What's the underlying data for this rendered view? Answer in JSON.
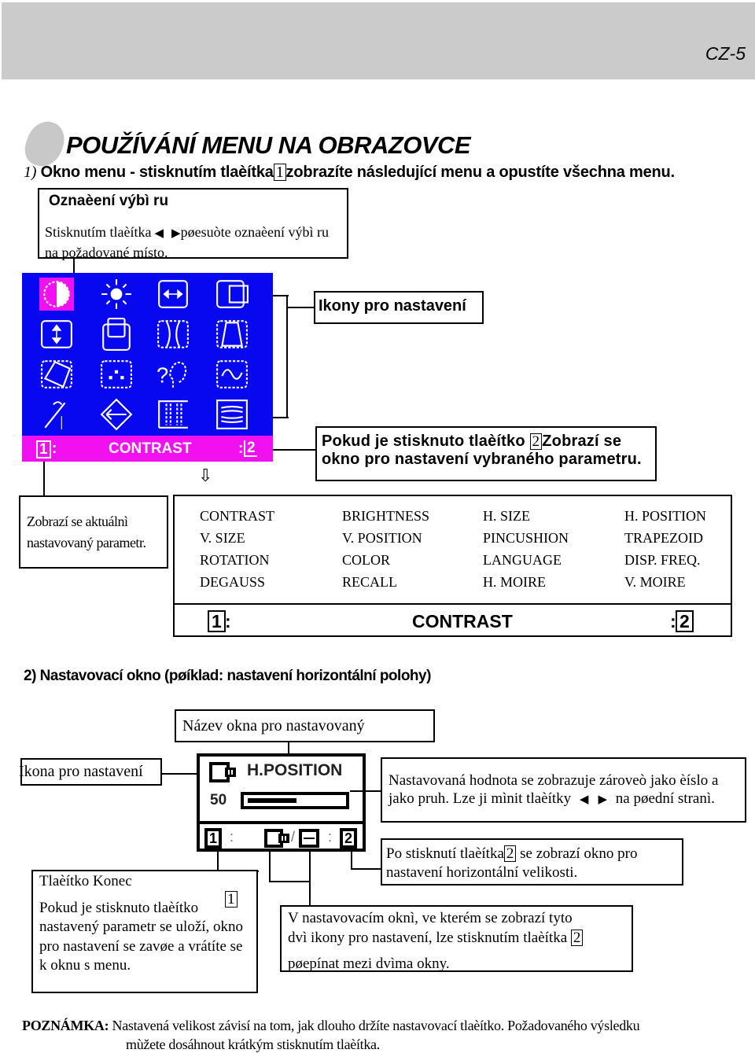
{
  "header": {
    "page_number": "CZ-5"
  },
  "title": "POUŽÍVÁNÍ MENU NA OBRAZOVCE",
  "step1": {
    "number": "1)",
    "text_before": "Okno menu - stisknutím tlaèítka",
    "key": "1",
    "text_after": "zobrazíte následující menu a opustíte všechna menu."
  },
  "selection_callout": {
    "heading": "Oznaèení výbì ru",
    "text_before": "Stisknutím tlaèítka",
    "left_arrow": "◀",
    "right_arrow": "▶",
    "text_after": "pøesuòte oznaèení výbì ru na požadované místo."
  },
  "osd_menu": {
    "colors": {
      "background": "#0808f0",
      "highlight": "#f010f0",
      "foreground": "#ffffff"
    },
    "icons": [
      [
        "contrast-icon",
        "brightness-icon",
        "h-size-icon",
        "h-position-icon"
      ],
      [
        "v-size-icon",
        "v-position-icon",
        "pincushion-icon",
        "trapezoid-icon"
      ],
      [
        "rotation-icon",
        "color-icon",
        "language-icon",
        "disp-freq-icon"
      ],
      [
        "degauss-icon",
        "recall-icon",
        "h-moire-icon",
        "v-moire-icon"
      ]
    ],
    "selected_index": 0,
    "status_bar": {
      "left_key": "1",
      "left_sep": ":",
      "label": "CONTRAST",
      "right_sep": ":",
      "right_key": "2"
    },
    "down_arrow": "⇩"
  },
  "icons_callout": "Ikony pro nastavení",
  "button2_callout": {
    "text_before": "Pokud je stisknuto tlaèítko",
    "key": "2",
    "text_after": "Zobrazí se okno pro nastavení vybraného parametru."
  },
  "current_param_callout": "Zobrazí se aktuálnì nastavovaný parametr.",
  "parameter_table": {
    "rows": [
      [
        "CONTRAST",
        "BRIGHTNESS",
        "H. SIZE",
        "H. POSITION"
      ],
      [
        "V. SIZE",
        "V. POSITION",
        "PINCUSHION",
        "TRAPEZOID"
      ],
      [
        "ROTATION",
        "COLOR",
        "LANGUAGE",
        "DISP. FREQ."
      ],
      [
        "DEGAUSS",
        "RECALL",
        "H. MOIRE",
        "V. MOIRE"
      ]
    ],
    "footer": {
      "left_key": "1",
      "left_sep": ":",
      "label": "CONTRAST",
      "right_sep": ":",
      "right_key": "2"
    }
  },
  "step2": {
    "text": "2) Nastavovací okno (pøíklad: nastavení horizontální polohy)"
  },
  "window_name_callout": "Název okna pro nastavovaný",
  "icon_callout": "Ikona pro nastavení",
  "adjust_window": {
    "title": "H.POSITION",
    "value": "50",
    "progress_percent": 50,
    "footer": {
      "left_key": "1",
      "sep1": ":",
      "slash": "/",
      "sep2": ":",
      "right_key": "2"
    }
  },
  "value_callout": {
    "text_before": "Nastavovaná hodnota se zobrazuje zároveò jako èíslo a jako pruh. Lze ji mìnit tlaèítky",
    "left_arrow": "◀",
    "right_arrow": "▶",
    "text_after": "na pøední stranì."
  },
  "button2_switch_callout": {
    "text_before": "Po stisknutí tlaèítka",
    "key": "2",
    "text_after": "se zobrazí okno pro nastavení horizontální velikosti."
  },
  "exit_callout": {
    "heading": "Tlaèítko Konec",
    "text_before": "Pokud je stisknuto tlaèítko",
    "key": "1",
    "text_after": "nastavený parametr se uloží, okno pro nastavení se zavøe a vrátíte se k oknu s menu."
  },
  "toggle_callout": {
    "line1": "V nastavovacím oknì, ve kterém se zobrazí tyto",
    "line2_before": "dvì  ikony pro nastavení, lze stisknutím tlaèítka",
    "key": "2",
    "line3": "pøepínat mezi dvìma okny."
  },
  "note": {
    "label": "POZNÁMKA:",
    "line1": "Nastavená velikost závisí na tom, jak dlouho držíte nastavovací tlaèítko. Požadovaného výsledku",
    "line2": "mùžete dosáhnout krátkým stisknutím tlaèítka."
  }
}
